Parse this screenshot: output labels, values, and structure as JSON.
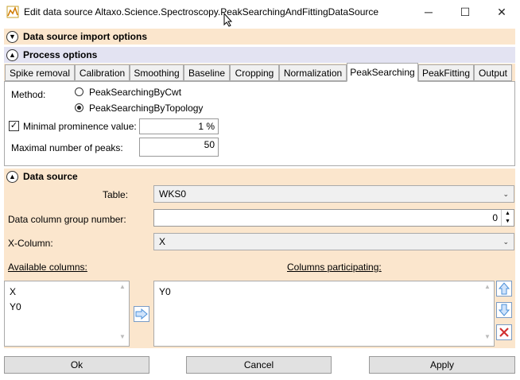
{
  "window": {
    "title": "Edit data source Altaxo.Science.Spectroscopy.PeakSearchingAndFittingDataSource",
    "minimize": "─",
    "maximize": "☐",
    "close": "✕"
  },
  "sections": {
    "import_options": "Data source import options",
    "process_options": "Process options",
    "data_source": "Data source"
  },
  "tabs": [
    {
      "label": "Spike removal"
    },
    {
      "label": "Calibration"
    },
    {
      "label": "Smoothing"
    },
    {
      "label": "Baseline"
    },
    {
      "label": "Cropping"
    },
    {
      "label": "Normalization"
    },
    {
      "label": "PeakSearching"
    },
    {
      "label": "PeakFitting"
    },
    {
      "label": "Output"
    }
  ],
  "peak_searching": {
    "method_label": "Method:",
    "options": [
      {
        "label": "PeakSearchingByCwt",
        "selected": false
      },
      {
        "label": "PeakSearchingByTopology",
        "selected": true
      }
    ],
    "minimal_prominence": {
      "label": "Minimal prominence value:",
      "checked": true,
      "value": "1 %"
    },
    "max_peaks": {
      "label": "Maximal number of peaks:",
      "value": "50"
    }
  },
  "data_source": {
    "table_label": "Table:",
    "table_value": "WKS0",
    "group_label": "Data column group number:",
    "group_value": "0",
    "xcol_label": "X-Column:",
    "xcol_value": "X",
    "available_label": "Available columns:",
    "available_items": [
      "X",
      "Y0"
    ],
    "participating_label": "Columns participating:",
    "participating_items": [
      "Y0"
    ]
  },
  "buttons": {
    "ok": "Ok",
    "cancel": "Cancel",
    "apply": "Apply"
  },
  "colors": {
    "section_bg": "#fbe6cd",
    "process_header_bg": "#e3e3f2",
    "arrow_blue": "#4a8fd8",
    "delete_red": "#d23030"
  }
}
